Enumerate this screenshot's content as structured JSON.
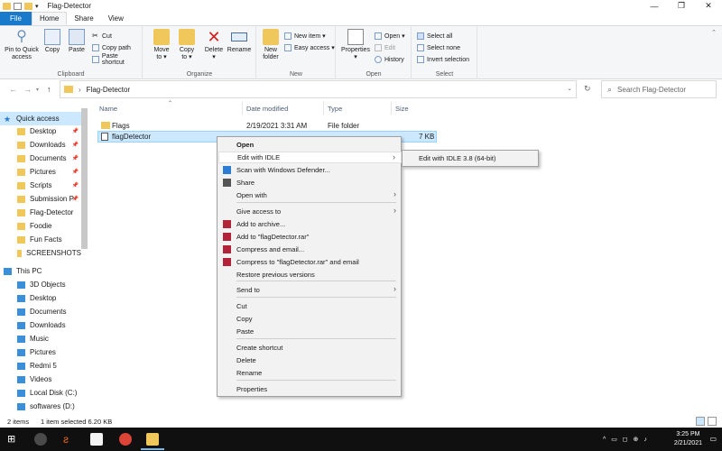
{
  "window": {
    "title": "Flag-Detector",
    "controls": [
      "—",
      "❐",
      "✕"
    ]
  },
  "ribbon_tabs": [
    {
      "label": "File"
    },
    {
      "label": "Home"
    },
    {
      "label": "Share"
    },
    {
      "label": "View"
    }
  ],
  "ribbon": {
    "clipboard": {
      "label": "Clipboard",
      "pin": "Pin to Quick\naccess",
      "copy": "Copy",
      "paste": "Paste",
      "cut": "Cut",
      "copy_path": "Copy path",
      "paste_shortcut": "Paste shortcut"
    },
    "organize": {
      "label": "Organize",
      "move_to": "Move\nto ▾",
      "copy_to": "Copy\nto ▾",
      "delete": "Delete\n▾",
      "rename": "Rename"
    },
    "new": {
      "label": "New",
      "new_folder": "New\nfolder",
      "new_item": "New item ▾",
      "easy_access": "Easy access ▾"
    },
    "open": {
      "label": "Open",
      "properties": "Properties\n▾",
      "open": "Open ▾",
      "edit": "Edit",
      "history": "History"
    },
    "select": {
      "label": "Select",
      "select_all": "Select all",
      "select_none": "Select none",
      "invert": "Invert selection"
    }
  },
  "address": {
    "path": "Flag-Detector",
    "search_placeholder": "Search Flag-Detector"
  },
  "nav_pane": {
    "quick_access": "Quick access",
    "items": [
      {
        "label": "Desktop",
        "pinned": true
      },
      {
        "label": "Downloads",
        "pinned": true
      },
      {
        "label": "Documents",
        "pinned": true
      },
      {
        "label": "Pictures",
        "pinned": true
      },
      {
        "label": "Scripts",
        "pinned": true
      },
      {
        "label": "Submission P",
        "pinned": true
      },
      {
        "label": "Flag-Detector",
        "pinned": false
      },
      {
        "label": "Foodie",
        "pinned": false
      },
      {
        "label": "Fun Facts",
        "pinned": false
      },
      {
        "label": "SCREENSHOTS",
        "pinned": false
      }
    ],
    "this_pc": "This PC",
    "pc_items": [
      {
        "label": "3D Objects"
      },
      {
        "label": "Desktop"
      },
      {
        "label": "Documents"
      },
      {
        "label": "Downloads"
      },
      {
        "label": "Music"
      },
      {
        "label": "Pictures"
      },
      {
        "label": "Redmi 5"
      },
      {
        "label": "Videos"
      },
      {
        "label": "Local Disk (C:)"
      },
      {
        "label": "softwares (D:)"
      }
    ]
  },
  "file_list": {
    "columns": [
      "Name",
      "Date modified",
      "Type",
      "Size"
    ],
    "rows": [
      {
        "name": "Flags",
        "date": "2/19/2021 3:31 AM",
        "type": "File folder",
        "size": ""
      },
      {
        "name": "flagDetector",
        "date": "",
        "type": "",
        "size": "7 KB"
      }
    ]
  },
  "context_menu": {
    "items": [
      {
        "label": "Open",
        "bold": true
      },
      {
        "label": "Edit with IDLE",
        "submenu": true
      },
      {
        "label": "Scan with Windows Defender..."
      },
      {
        "label": "Share"
      },
      {
        "label": "Open with",
        "submenu": true
      },
      {
        "label": "Give access to",
        "submenu": true
      },
      {
        "label": "Add to archive..."
      },
      {
        "label": "Add to \"flagDetector.rar\""
      },
      {
        "label": "Compress and email..."
      },
      {
        "label": "Compress to \"flagDetector.rar\" and email"
      },
      {
        "label": "Restore previous versions"
      },
      {
        "label": "Send to",
        "submenu": true
      },
      {
        "label": "Cut"
      },
      {
        "label": "Copy"
      },
      {
        "label": "Paste"
      },
      {
        "label": "Create shortcut"
      },
      {
        "label": "Delete"
      },
      {
        "label": "Rename"
      },
      {
        "label": "Properties"
      }
    ],
    "submenu_item": "Edit with IDLE 3.8 (64-bit)"
  },
  "status_bar": {
    "count": "2 items",
    "selection": "1 item selected  6.20 KB"
  },
  "taskbar": {
    "time": "3:25 PM",
    "date": "2/21/2021",
    "tray": "^  ▭  ◻  ⊕  ♪"
  },
  "colors": {
    "accent": "#1979ca",
    "selection": "#cce8ff",
    "taskbar": "#101010"
  }
}
